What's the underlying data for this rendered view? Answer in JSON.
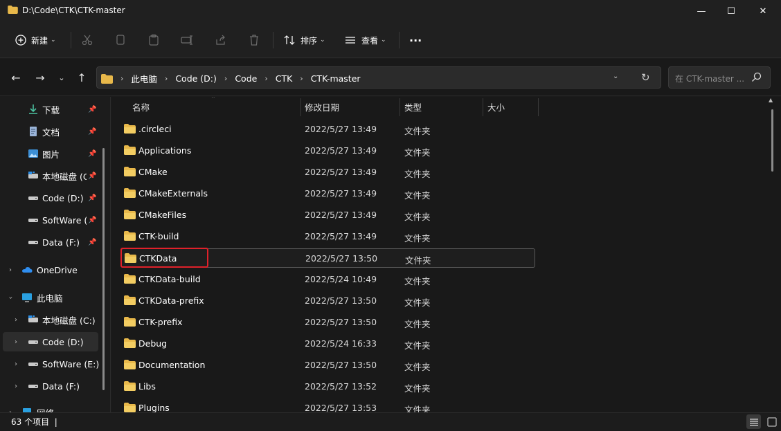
{
  "window": {
    "title": "D:\\Code\\CTK\\CTK-master",
    "minimize": "—",
    "maximize": "☐",
    "close": "✕"
  },
  "toolbar": {
    "new_label": "新建",
    "sort_label": "排序",
    "view_label": "查看",
    "more_label": "···"
  },
  "nav": {
    "breadcrumbs": [
      "此电脑",
      "Code (D:)",
      "Code",
      "CTK",
      "CTK-master"
    ],
    "search_placeholder": "在 CTK-master ..."
  },
  "sidebar": {
    "items": [
      {
        "label": "下载",
        "icon": "download-icon",
        "pinned": true
      },
      {
        "label": "文档",
        "icon": "document-icon",
        "pinned": true
      },
      {
        "label": "图片",
        "icon": "picture-icon",
        "pinned": true
      },
      {
        "label": "本地磁盘 (C",
        "icon": "drive-icon",
        "pinned": true
      },
      {
        "label": "Code (D:)",
        "icon": "drive-icon",
        "pinned": true
      },
      {
        "label": "SoftWare (I",
        "icon": "drive-icon",
        "pinned": true
      },
      {
        "label": "Data (F:)",
        "icon": "drive-icon",
        "pinned": true
      },
      {
        "label": "OneDrive",
        "icon": "cloud-icon"
      },
      {
        "label": "此电脑",
        "icon": "computer-icon"
      },
      {
        "label": "本地磁盘 (C:)",
        "icon": "drive-icon"
      },
      {
        "label": "Code (D:)",
        "icon": "drive-icon",
        "selected": true
      },
      {
        "label": "SoftWare (E:)",
        "icon": "drive-icon"
      },
      {
        "label": "Data (F:)",
        "icon": "drive-icon"
      },
      {
        "label": "网络",
        "icon": "network-icon"
      }
    ]
  },
  "columns": {
    "name": "名称",
    "date": "修改日期",
    "type": "类型",
    "size": "大小"
  },
  "files": [
    {
      "name": ".circleci",
      "date": "2022/5/27 13:49",
      "type": "文件夹"
    },
    {
      "name": "Applications",
      "date": "2022/5/27 13:49",
      "type": "文件夹"
    },
    {
      "name": "CMake",
      "date": "2022/5/27 13:49",
      "type": "文件夹"
    },
    {
      "name": "CMakeExternals",
      "date": "2022/5/27 13:49",
      "type": "文件夹"
    },
    {
      "name": "CMakeFiles",
      "date": "2022/5/27 13:49",
      "type": "文件夹"
    },
    {
      "name": "CTK-build",
      "date": "2022/5/27 13:49",
      "type": "文件夹"
    },
    {
      "name": "CTKData",
      "date": "2022/5/27 13:50",
      "type": "文件夹",
      "selected": true
    },
    {
      "name": "CTKData-build",
      "date": "2022/5/24 10:49",
      "type": "文件夹"
    },
    {
      "name": "CTKData-prefix",
      "date": "2022/5/27 13:50",
      "type": "文件夹"
    },
    {
      "name": "CTK-prefix",
      "date": "2022/5/27 13:50",
      "type": "文件夹"
    },
    {
      "name": "Debug",
      "date": "2022/5/24 16:33",
      "type": "文件夹"
    },
    {
      "name": "Documentation",
      "date": "2022/5/27 13:50",
      "type": "文件夹"
    },
    {
      "name": "Libs",
      "date": "2022/5/27 13:52",
      "type": "文件夹"
    },
    {
      "name": "Plugins",
      "date": "2022/5/27 13:53",
      "type": "文件夹"
    }
  ],
  "status": {
    "item_count": "63 个项目",
    "separator": "|"
  },
  "colors": {
    "folder": "#e8b84a",
    "highlight": "#e0212a",
    "background": "#191919"
  }
}
